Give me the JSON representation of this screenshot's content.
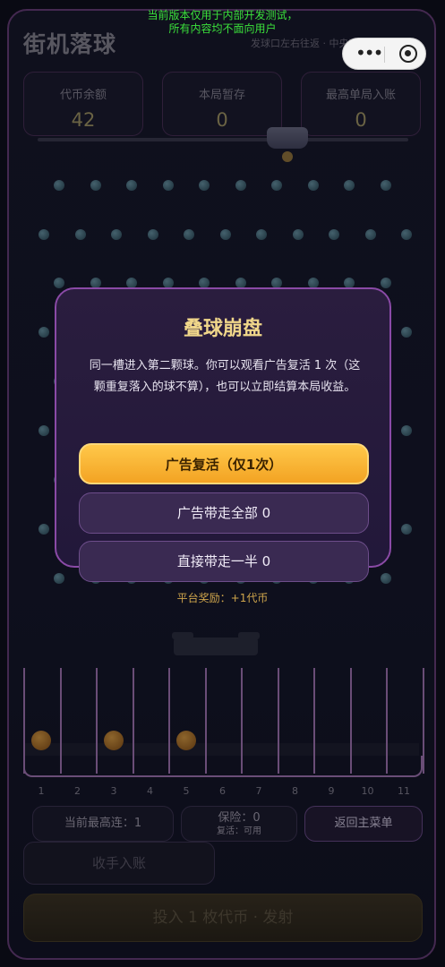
{
  "dev_notice": {
    "line1": "当前版本仅用于内部开发测试，",
    "line2": "所有内容均不面向用户"
  },
  "header": {
    "title": "街机落球",
    "hint": "发球口左右往返 · 中央穿过平台可获奖"
  },
  "capsule": {
    "more_icon": "more-dots-icon",
    "close_icon": "target-circle-icon"
  },
  "stats": [
    {
      "label": "代币余额",
      "value": "42"
    },
    {
      "label": "本局暂存",
      "value": "0"
    },
    {
      "label": "最高单局入账",
      "value": "0"
    }
  ],
  "modal": {
    "title": "叠球崩盘",
    "body": "同一槽进入第二颗球。你可以观看广告复活 1 次（这颗重复落入的球不算），也可以立即结算本局收益。",
    "btn_revive": "广告复活（仅1次）",
    "btn_take_all": "广告带走全部 0",
    "btn_take_half": "直接带走一半 0"
  },
  "reward_text": "平台奖励：+1代币",
  "slots": {
    "numbers": [
      "1",
      "2",
      "3",
      "4",
      "5",
      "6",
      "7",
      "8",
      "9",
      "10",
      "11"
    ],
    "filled": [
      1,
      3,
      5
    ]
  },
  "bottom": {
    "combo": "当前最高连：1",
    "insurance_line1": "保险：0",
    "insurance_line2": "复活：可用",
    "menu": "返回主菜单",
    "collect": "收手入账",
    "launch": "投入 1 枚代币 · 发射"
  },
  "colors": {
    "accent_gold": "#f3a323",
    "frame_purple": "#8a4aa6",
    "dev_green": "#3be03b"
  }
}
